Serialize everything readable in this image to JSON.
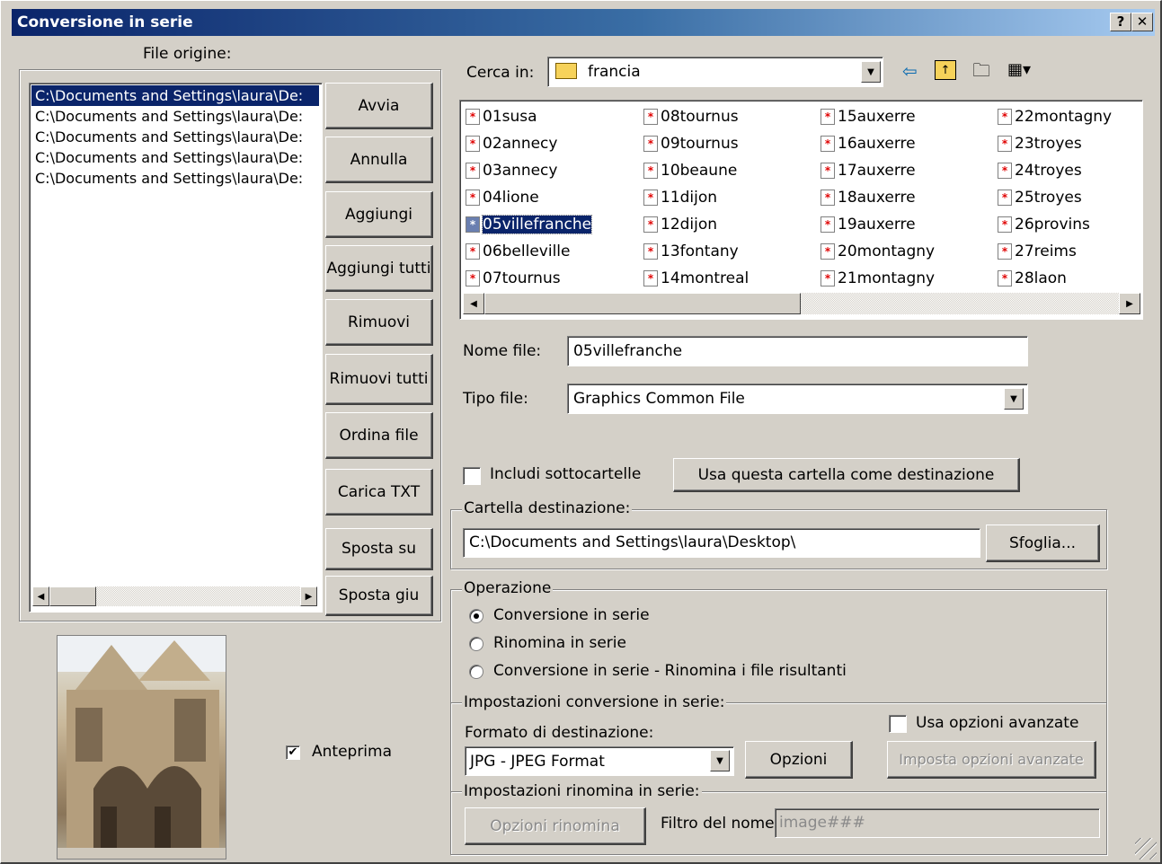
{
  "dialog": {
    "title": "Conversione in serie",
    "help_label": "?",
    "close_label": "✕"
  },
  "source": {
    "label": "File origine:",
    "files": [
      "C:\\Documents and Settings\\laura\\De:",
      "C:\\Documents and Settings\\laura\\De:",
      "C:\\Documents and Settings\\laura\\De:",
      "C:\\Documents and Settings\\laura\\De:",
      "C:\\Documents and Settings\\laura\\De:"
    ],
    "selected_index": 0
  },
  "buttons": {
    "avvia": "Avvia",
    "annulla": "Annulla",
    "aggiungi": "Aggiungi",
    "aggiungi_tutti": "Aggiungi tutti",
    "rimuovi": "Rimuovi",
    "rimuovi_tutti": "Rimuovi tutti",
    "ordina_file": "Ordina file",
    "carica_txt": "Carica TXT",
    "sposta_su": "Sposta su",
    "sposta_giu": "Sposta giu"
  },
  "preview": {
    "checkbox_label": "Anteprima",
    "checked": true
  },
  "browser": {
    "look_in_label": "Cerca in:",
    "folder": "francia",
    "files": [
      "01susa",
      "02annecy",
      "03annecy",
      "04lione",
      "05villefranche",
      "06belleville",
      "07tournus",
      "08tournus",
      "09tournus",
      "10beaune",
      "11dijon",
      "12dijon",
      "13fontany",
      "14montreal",
      "15auxerre",
      "16auxerre",
      "17auxerre",
      "18auxerre",
      "19auxerre",
      "20montagny",
      "21montagny",
      "22montagny",
      "23troyes",
      "24troyes",
      "25troyes",
      "26provins",
      "27reims",
      "28laon"
    ],
    "selected_file": "05villefranche",
    "filename_label": "Nome file:",
    "filename_value": "05villefranche",
    "filetype_label": "Tipo file:",
    "filetype_value": "Graphics Common File",
    "include_subfolders_label": "Includi sottocartelle",
    "include_subfolders_checked": false,
    "use_as_dest_button": "Usa questa cartella come destinazione"
  },
  "destination": {
    "group_label": "Cartella destinazione:",
    "path": "C:\\Documents and Settings\\laura\\Desktop\\",
    "browse_button": "Sfoglia..."
  },
  "operation": {
    "group_label": "Operazione",
    "options": [
      "Conversione in serie",
      "Rinomina in serie",
      "Conversione in serie - Rinomina i file risultanti"
    ],
    "selected_index": 0
  },
  "conversion": {
    "group_label": "Impostazioni conversione in serie:",
    "format_label": "Formato di destinazione:",
    "format_value": "JPG - JPEG Format",
    "options_button": "Opzioni",
    "advanced_checkbox_label": "Usa opzioni avanzate",
    "advanced_checked": false,
    "advanced_button": "Imposta opzioni avanzate"
  },
  "rename": {
    "group_label": "Impostazioni rinomina in serie:",
    "options_button": "Opzioni rinomina",
    "filter_label": "Filtro del nome:",
    "filter_value": "image###"
  },
  "colors": {
    "title_start": "#0a246a",
    "title_end": "#a6caf0",
    "selection": "#0a246a",
    "face": "#d4d0c8"
  }
}
